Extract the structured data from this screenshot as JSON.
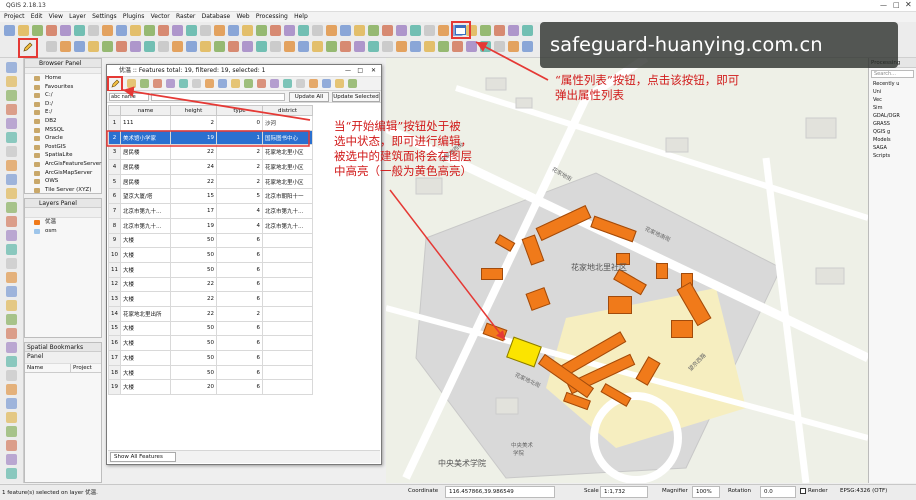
{
  "app": {
    "title": "QGIS 2.18.13",
    "menu": [
      "Project",
      "Edit",
      "View",
      "Layer",
      "Settings",
      "Plugins",
      "Vector",
      "Raster",
      "Database",
      "Web",
      "Processing",
      "Help"
    ]
  },
  "browser_panel": {
    "title": "Browser Panel",
    "items": [
      "Home",
      "Favourites",
      "C:/",
      "D:/",
      "E:/",
      "DB2",
      "MSSQL",
      "Oracle",
      "PostGIS",
      "SpatiaLite",
      "ArcGisFeatureServer",
      "ArcGisMapServer",
      "OWS",
      "Tile Server (XYZ)"
    ]
  },
  "layers_panel": {
    "title": "Layers Panel",
    "layers": [
      "优温",
      "osm"
    ]
  },
  "bookmarks_panel": {
    "title": "Spatial Bookmarks Panel",
    "columns": [
      "Name",
      "Project"
    ]
  },
  "attribute_table": {
    "title": "优温 :: Features total: 19, filtered: 19, selected: 1",
    "field_select": "abc name",
    "update_all": "Update All",
    "update_selected": "Update Selected",
    "columns": [
      "name",
      "height",
      "type",
      "district"
    ],
    "rows": [
      [
        "111",
        "2",
        "0",
        "沙河"
      ],
      [
        "美术馆小学家",
        "19",
        "1",
        "国际图书中心"
      ],
      [
        "居民楼",
        "22",
        "2",
        "花家地北里小区"
      ],
      [
        "居民楼",
        "24",
        "2",
        "花家地北里小区"
      ],
      [
        "居民楼",
        "22",
        "2",
        "花家地北里小区"
      ],
      [
        "望京大厦/塔",
        "15",
        "5",
        "北京市朝阳十一"
      ],
      [
        "北京市第九十…",
        "17",
        "4",
        "北京市第九十…"
      ],
      [
        "北京市第九十…",
        "19",
        "4",
        "北京市第九十…"
      ],
      [
        "大楼",
        "50",
        "6",
        ""
      ],
      [
        "大楼",
        "50",
        "6",
        ""
      ],
      [
        "大楼",
        "50",
        "6",
        ""
      ],
      [
        "大楼",
        "22",
        "6",
        ""
      ],
      [
        "大楼",
        "22",
        "6",
        ""
      ],
      [
        "花家地北里出所",
        "22",
        "2",
        ""
      ],
      [
        "大楼",
        "50",
        "6",
        ""
      ],
      [
        "大楼",
        "50",
        "6",
        ""
      ],
      [
        "大楼",
        "50",
        "6",
        ""
      ],
      [
        "大楼",
        "50",
        "6",
        ""
      ],
      [
        "大楼",
        "20",
        "6",
        ""
      ]
    ],
    "selected_row": 1,
    "show_all_features": "Show All Features"
  },
  "annotations": {
    "attr_button_note_line1": "“属性列表”按钮，点击该按钮，即可",
    "attr_button_note_line2": "弹出属性列表",
    "edit_note_line1": "当“开始编辑”按钮处于被",
    "edit_note_line2": "选中状态，即可进行编辑，",
    "edit_note_line3": "被选中的建筑面将会在图层",
    "edit_note_line4": "中高亮（一般为黄色高亮）"
  },
  "watermark": "safeguard-huanying.com.cn",
  "map_labels": {
    "district": "花家地北里社区",
    "academy": "中央美术学院",
    "academy_bottom": "中央美术",
    "academy_bottom2": "学院",
    "roads": [
      "花家地西街",
      "花家地街",
      "花家地南街",
      "望京西路",
      "花家地北街"
    ]
  },
  "right_panel": {
    "title": "Processing",
    "search": "Search...",
    "items": [
      "Recently u",
      "Uni",
      "Vec",
      "Sim",
      "GDAL/OGR",
      "GRASS",
      "QGIS g",
      "Models",
      "SAGA",
      "Scripts"
    ]
  },
  "status": {
    "message": "1 feature(s) selected on layer 优温.",
    "coordinate_label": "Coordinate",
    "coordinate": "116.457866,39.986549",
    "scale_label": "Scale",
    "scale": "1:1,732",
    "magnifier_label": "Magnifier",
    "magnifier": "100%",
    "rotation_label": "Rotation",
    "rotation": "0.0",
    "render_label": "Render",
    "crs": "EPSG:4326 (OTF)"
  },
  "colors": {
    "highlight_red": "#e53935",
    "building_orange": "#f07a1a",
    "selected_yellow": "#fbe400",
    "selection_blue": "#2a70d0"
  }
}
